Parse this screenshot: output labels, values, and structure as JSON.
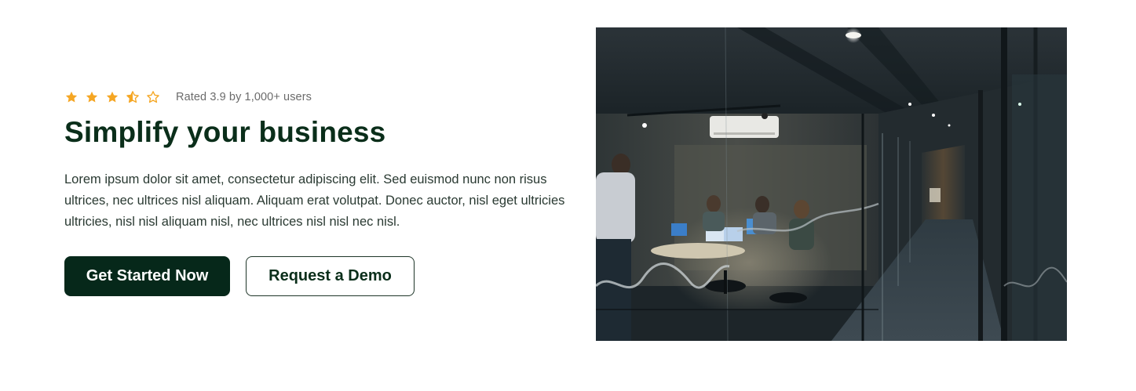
{
  "rating": {
    "value": 3.9,
    "max": 5,
    "text": "Rated 3.9 by 1,000+ users",
    "star_color": "#f5a623"
  },
  "hero": {
    "title": "Simplify your business",
    "description": "Lorem ipsum dolor sit amet, consectetur adipiscing elit. Sed euismod nunc non risus ultrices, nec ultrices nisl aliquam. Aliquam erat volutpat. Donec auctor, nisl eget ultricies ultricies, nisl nisl aliquam nisl, nec ultrices nisl nisl nec nisl."
  },
  "actions": {
    "primary_label": "Get Started Now",
    "secondary_label": "Request a Demo"
  },
  "colors": {
    "brand_dark": "#06281a",
    "title": "#0a2e1a",
    "muted_text": "#6b6b6b"
  },
  "image": {
    "subject": "office-meeting-room-photo"
  }
}
